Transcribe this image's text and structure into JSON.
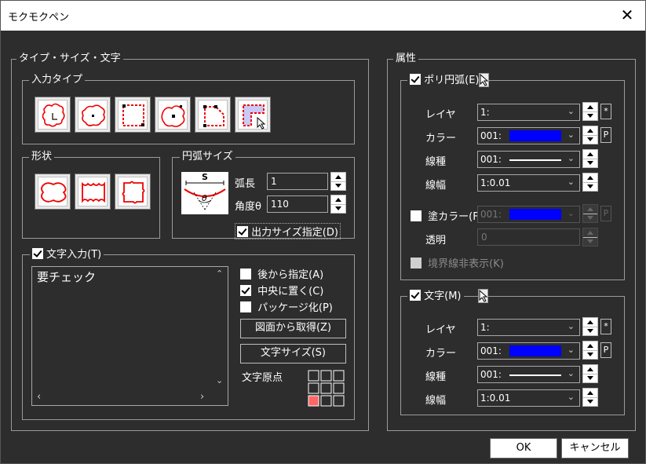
{
  "window": {
    "title": "モクモクペン"
  },
  "left": {
    "title": "タイプ・サイズ・文字",
    "input_type": {
      "title": "入力タイプ"
    },
    "shape": {
      "title": "形状"
    },
    "arc_size": {
      "title": "円弧サイズ",
      "length_label": "弧長",
      "length_value": "1",
      "angle_label": "角度θ",
      "angle_value": "110",
      "output_size_label": "出力サイズ指定(D)",
      "diagram_s": "S",
      "diagram_theta": "θ"
    },
    "text_input": {
      "label": "文字入力(T)",
      "content": "要チェック",
      "specify_later": "後から指定(A)",
      "center": "中央に置く(C)",
      "package": "パッケージ化(P)",
      "get_from_drawing": "図面から取得(Z)",
      "text_size": "文字サイズ(S)",
      "origin_label": "文字原点"
    }
  },
  "right": {
    "title": "属性",
    "poly_arc": {
      "label": "ポリ円弧(E)",
      "layer_label": "レイヤ",
      "layer_value": "1:",
      "color_label": "カラー",
      "color_value": "001:",
      "color_hex": "#0000ff",
      "linetype_label": "線種",
      "linetype_value": "001:",
      "linewidth_label": "線幅",
      "linewidth_value": "1:0.01",
      "fill_label": "塗カラー(F)",
      "fill_value": "001:",
      "transparency_label": "透明",
      "transparency_value": "0",
      "hide_border_label": "境界線非表示(K)",
      "star_tag": "*",
      "p_tag": "P"
    },
    "text": {
      "label": "文字(M)",
      "layer_label": "レイヤ",
      "layer_value": "1:",
      "color_label": "カラー",
      "color_value": "001:",
      "linetype_label": "線種",
      "linetype_value": "001:",
      "linewidth_label": "線幅",
      "linewidth_value": "1:0.01",
      "star_tag": "*",
      "p_tag": "P"
    }
  },
  "buttons": {
    "ok": "OK",
    "cancel": "キャンセル"
  }
}
